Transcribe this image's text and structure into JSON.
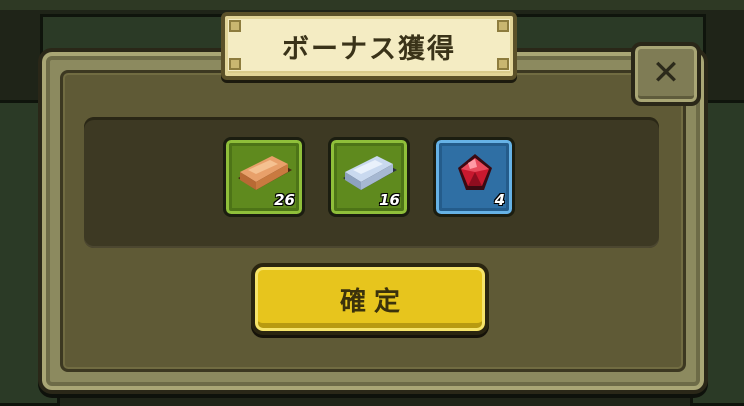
{
  "dialog": {
    "title": "ボーナス獲得",
    "confirm_label": "確定"
  },
  "rewards": [
    {
      "icon": "copper-ingot-icon",
      "count": "26",
      "frame_color": "#5f8a1e"
    },
    {
      "icon": "silver-ingot-icon",
      "count": "16",
      "frame_color": "#5f8a1e"
    },
    {
      "icon": "red-gem-icon",
      "count": "4",
      "frame_color": "#2f6fa4"
    }
  ],
  "colors": {
    "confirm_button": "#e7c51d",
    "title_banner": "#f4ecc3",
    "dialog_frame": "#8c8a5f"
  }
}
